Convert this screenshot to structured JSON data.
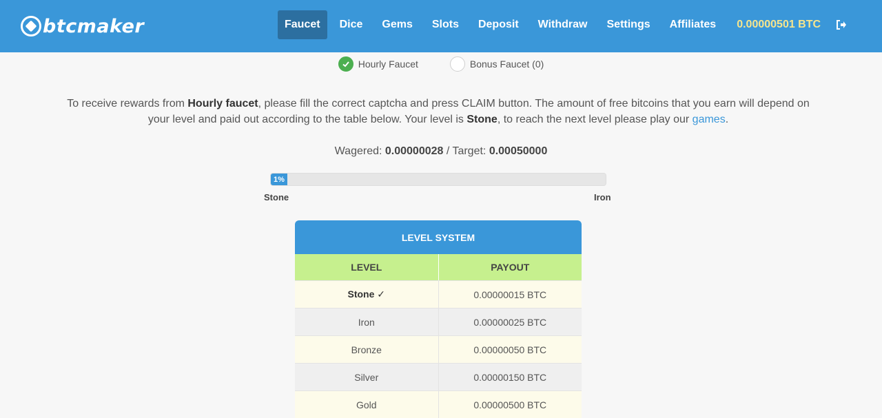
{
  "header": {
    "brand": "btcmaker",
    "nav": [
      {
        "label": "Faucet",
        "active": true
      },
      {
        "label": "Dice"
      },
      {
        "label": "Gems"
      },
      {
        "label": "Slots"
      },
      {
        "label": "Deposit"
      },
      {
        "label": "Withdraw"
      },
      {
        "label": "Settings"
      },
      {
        "label": "Affiliates"
      }
    ],
    "balance": "0.00000501 BTC",
    "logout_icon": "logout-icon"
  },
  "faucet_options": [
    {
      "label": "Hourly Faucet",
      "selected": true
    },
    {
      "label": "Bonus Faucet (0)",
      "selected": false
    }
  ],
  "intro": {
    "p1": "To receive rewards from ",
    "b1": "Hourly faucet",
    "p2": ", please fill the correct captcha and press CLAIM button. The amount of free bitcoins that you earn will depend on your level and paid out according to the table below. Your level is ",
    "b2": "Stone",
    "p3": ", to reach the next level please play our ",
    "link": "games",
    "p4": "."
  },
  "wager": {
    "wagered_label": "Wagered: ",
    "wagered_value": "0.00000028",
    "sep": " / ",
    "target_label": "Target: ",
    "target_value": "0.00050000"
  },
  "progress": {
    "percent_text": "1%",
    "fraction": 0.01,
    "from_level": "Stone",
    "to_level": "Iron"
  },
  "level_table": {
    "title": "LEVEL SYSTEM",
    "columns": [
      "LEVEL",
      "PAYOUT"
    ],
    "rows": [
      {
        "level": "Stone ✓",
        "payout": "0.00000015 BTC",
        "current": true
      },
      {
        "level": "Iron",
        "payout": "0.00000025 BTC"
      },
      {
        "level": "Bronze",
        "payout": "0.00000050 BTC"
      },
      {
        "level": "Silver",
        "payout": "0.00000150 BTC"
      },
      {
        "level": "Gold",
        "payout": "0.00000500 BTC"
      }
    ]
  },
  "colors": {
    "topbar": "#3a97d9",
    "nav_active": "#2c6fa0",
    "balance": "#f6e58d",
    "table_header": "#3a97d9",
    "table_columns": "#c6f08e",
    "row_odd": "#fdfbea",
    "row_even": "#efefef",
    "check_green": "#4caf50"
  }
}
